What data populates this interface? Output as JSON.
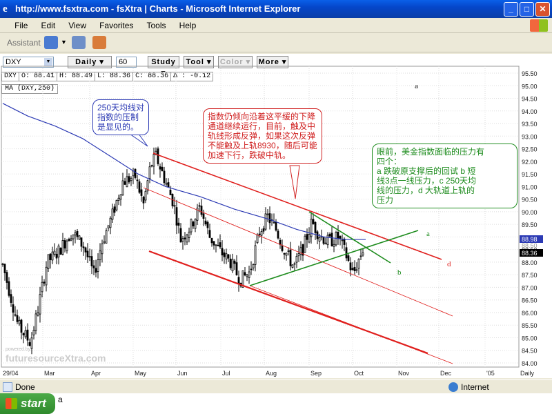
{
  "window": {
    "title": "http://www.fsxtra.com - fsXtra | Charts - Microsoft Internet Explorer",
    "buttons": {
      "minimize": "_",
      "maximize": "□",
      "close": "✕"
    }
  },
  "menu": [
    "File",
    "Edit",
    "View",
    "Favorites",
    "Tools",
    "Help"
  ],
  "assistant": {
    "label": "Assistant"
  },
  "chart_toolbar": {
    "symbol": "DXY",
    "period": "60",
    "buttons": [
      "Daily ▾",
      "Study ▾",
      "Tool ▾",
      "Color ▾",
      "More ▾"
    ]
  },
  "quote": {
    "symbol": "DXY",
    "open": "O: 88.41",
    "high": "H: 88.49",
    "low": "L: 88.36",
    "close": "C: 88.36",
    "change": "Δ : -0.12"
  },
  "study_label": "MA (DXY,250)",
  "annotations": {
    "ma_note": [
      "250天均线对",
      "指数的压制",
      "是显见的。"
    ],
    "channel_note": [
      "指数仍倾向沿着这平缓的下降",
      "通道继续运行，目前，触及中",
      "轨线形成反弹，如果这次反弹",
      "不能触及上轨8930，随后可能",
      "加速下行，跌破中轨。"
    ],
    "pressure_note": [
      "眼前，美金指数面临的压力有",
      "四个：",
      "a 跌破原支撑后的回试 b 短",
      "线3点一线压力，c 250天均",
      "线的压力，d 大轨道上轨的",
      "压力"
    ],
    "line_labels": {
      "a": "a",
      "b": "b",
      "d": "d"
    },
    "corner_a": "a",
    "watermark": "futuresourceXtra.com",
    "watermark_small": "powered by"
  },
  "chart_data": {
    "type": "candlestick",
    "symbol": "DXY",
    "y_ticks": [
      "95.50",
      "95.00",
      "94.50",
      "94.00",
      "93.50",
      "93.00",
      "92.50",
      "92.00",
      "91.50",
      "91.00",
      "90.50",
      "90.00",
      "89.50",
      "89.00",
      "88.50",
      "88.00",
      "87.50",
      "87.00",
      "86.50",
      "86.00",
      "85.50",
      "85.00",
      "84.50",
      "84.00"
    ],
    "ylim": [
      84.0,
      95.5
    ],
    "x_ticks": [
      "29/04",
      "Mar",
      "Apr",
      "May",
      "Jun",
      "Jul",
      "Aug",
      "Sep",
      "Oct",
      "Nov",
      "Dec",
      "'05",
      "Daily"
    ],
    "price_tags": [
      {
        "value": "88.98",
        "color": "#2C3AB4"
      },
      {
        "value": "88.36",
        "color": "#000000"
      }
    ],
    "price_tag_hidden": "88.50",
    "colors": {
      "candles": "#000000",
      "ma": "#2C3AB4",
      "channel": "#E0201E",
      "trend": "#1E8C1E"
    }
  }
}
